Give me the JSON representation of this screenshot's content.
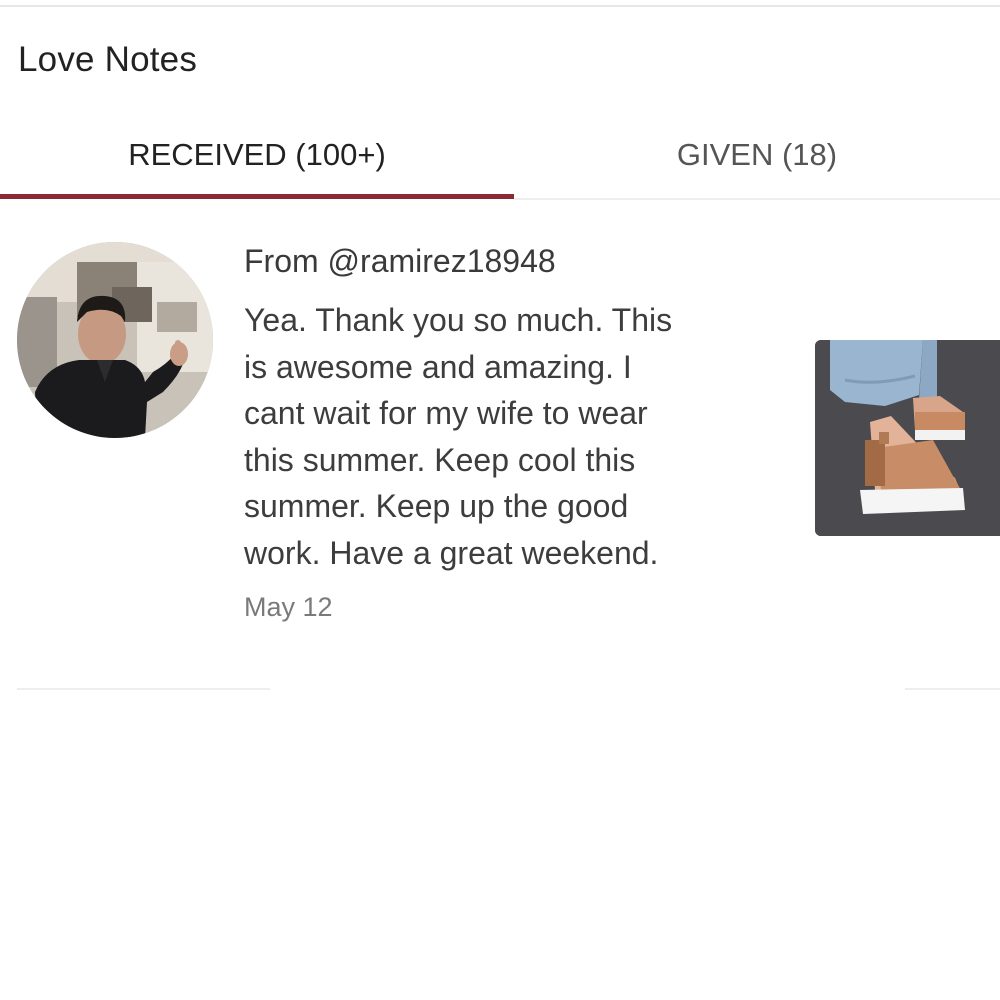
{
  "header": {
    "title": "Love Notes"
  },
  "tabs": [
    {
      "label": "RECEIVED (100+)",
      "active": true
    },
    {
      "label": "GIVEN (18)",
      "active": false
    }
  ],
  "colors": {
    "accent": "#8b2a33",
    "text_primary": "#222222",
    "text_secondary": "#7a7a7a"
  },
  "note": {
    "from_prefix": "From",
    "handle": "@ramirez18948",
    "message": "Yea. Thank you so much. This\nis awesome and amazing. I\ncant wait for my wife to wear\nthis summer. Keep cool this\nsummer. Keep up the good\nwork. Have a great weekend.",
    "date": "May 12",
    "avatar_icon": "user-avatar-photo",
    "product_icon": "product-photo-wedge-sandals"
  }
}
